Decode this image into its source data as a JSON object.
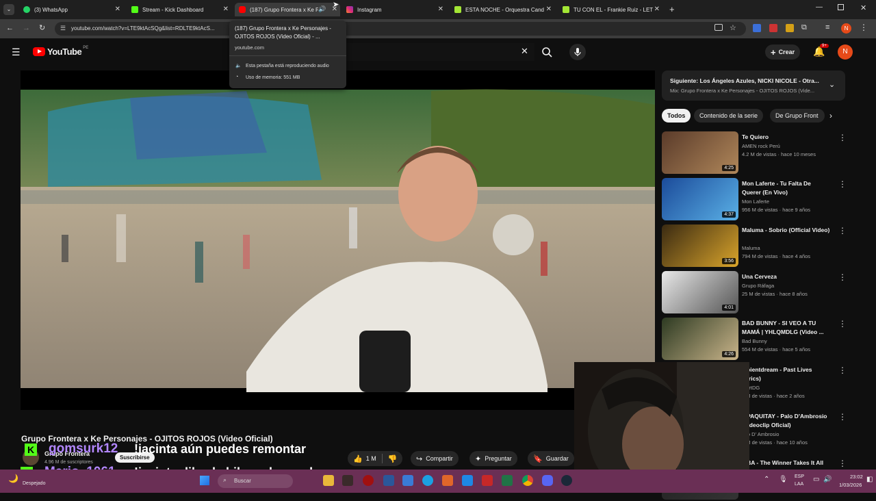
{
  "tabs": [
    {
      "label": "(3) WhatsApp",
      "color": "#25d366"
    },
    {
      "label": "Stream - Kick Dashboard",
      "color": "#53fc18"
    },
    {
      "label": "(187) Grupo Frontera x Ke P",
      "color": "#ff0000"
    },
    {
      "label": "Instagram",
      "color": "#e1306c"
    },
    {
      "label": "ESTA NOCHE - Orquestra Cand",
      "color": "#a3e635"
    },
    {
      "label": "TU CON EL - Frankie Ruiz - LET",
      "color": "#a3e635"
    }
  ],
  "address_bar": {
    "url": "youtube.com/watch?v=LTE9ktAcSQg&list=RDLTE9ktAcS..."
  },
  "tab_tooltip": {
    "title": "(187) Grupo Frontera x Ke Personajes - OJITOS ROJOS (Video Oficial) - ...",
    "domain": "youtube.com",
    "audio": "Esta pestaña está reproduciendo audio",
    "memory": "Uso de memoria: 551 MB"
  },
  "youtube": {
    "logo": "YouTube",
    "region": "PE",
    "create_label": "Crear",
    "notif_count": "9+",
    "avatar_letter": "N"
  },
  "video": {
    "title": "Grupo Frontera x Ke Personajes - OJITOS ROJOS (Video Oficial)",
    "channel": "Grupo Frontera",
    "subscribers": "4.96 M de suscriptores",
    "subscribe_label": "Suscribirse",
    "likes": "1 M",
    "share_label": "Compartir",
    "ask_label": "Preguntar",
    "save_label": "Guardar"
  },
  "playlist": {
    "next": "Siguiente: Los Ángeles Azules, NICKI NICOLE - Otra...",
    "mix": "Mix: Grupo Frontera x Ke Personajes - OJITOS ROJOS (Vide..."
  },
  "chips": [
    "Todos",
    "Contenido de la serie",
    "De Grupo Front"
  ],
  "recommendations": [
    {
      "title": "Te Quiero",
      "channel": "AMEN rock Perú",
      "meta": "4.2 M de vistas · hace 10 meses",
      "duration": "4:25",
      "colors": [
        "#5a3b2a",
        "#b0875a"
      ]
    },
    {
      "title": "Mon Laferte - Tu Falta De Querer (En Vivo)",
      "channel": "Mon Laferte",
      "meta": "956 M de vistas · hace 9 años",
      "duration": "4:37",
      "colors": [
        "#1b4b9a",
        "#5ab0e6"
      ]
    },
    {
      "title": "Maluma - Sobrio (Official Video)",
      "channel": "Maluma",
      "meta": "794 M de vistas · hace 4 años",
      "duration": "3:56",
      "colors": [
        "#3a2a12",
        "#d9a42b"
      ]
    },
    {
      "title": "Una Cerveza",
      "channel": "Grupo Ráfaga",
      "meta": "25 M de vistas · hace 8 años",
      "duration": "4:01",
      "colors": [
        "#e8e8e8",
        "#555555"
      ]
    },
    {
      "title": "BAD BUNNY - SI VEO A TU MAMÁ | YHLQMDLG (Video ...",
      "channel": "Bad Bunny",
      "meta": "554 M de vistas · hace 5 años",
      "duration": "4:26",
      "colors": [
        "#2d3a22",
        "#c9b48a"
      ]
    },
    {
      "title": "...pientdream - Past Lives (lyrics)",
      "channel": "...ertDG",
      "meta": "...M de vistas · hace 2 años",
      "duration": "",
      "colors": [
        "#222",
        "#333"
      ]
    },
    {
      "title": "...PAQUITAY - Palo D'Ambrosio (Videoclip Oficial)",
      "channel": "...lo D' Ambrosio",
      "meta": "...M de vistas · hace 10 años",
      "duration": "",
      "colors": [
        "#222",
        "#333"
      ]
    },
    {
      "title": "...BA - The Winner Takes It All",
      "channel": "",
      "meta": "",
      "duration": "",
      "colors": [
        "#222",
        "#333"
      ]
    }
  ],
  "chat": [
    {
      "user": "gomsurk12",
      "message": "!jacinta aún puedes remontar"
    },
    {
      "user": "Mario_1061",
      "message": "!jacinta dile al chil que lo parche"
    }
  ],
  "taskbar": {
    "weather": "Despejado",
    "search": "Buscar",
    "lang1": "ESP",
    "lang2": "LAA",
    "time": "23:02",
    "date": "1/03/2026"
  }
}
